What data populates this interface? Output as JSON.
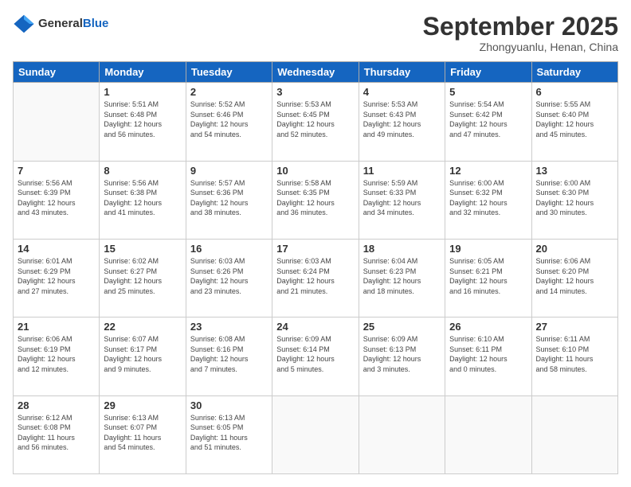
{
  "header": {
    "logo_general": "General",
    "logo_blue": "Blue",
    "month_title": "September 2025",
    "subtitle": "Zhongyuanlu, Henan, China"
  },
  "weekdays": [
    "Sunday",
    "Monday",
    "Tuesday",
    "Wednesday",
    "Thursday",
    "Friday",
    "Saturday"
  ],
  "weeks": [
    [
      {
        "day": "",
        "info": ""
      },
      {
        "day": "1",
        "info": "Sunrise: 5:51 AM\nSunset: 6:48 PM\nDaylight: 12 hours\nand 56 minutes."
      },
      {
        "day": "2",
        "info": "Sunrise: 5:52 AM\nSunset: 6:46 PM\nDaylight: 12 hours\nand 54 minutes."
      },
      {
        "day": "3",
        "info": "Sunrise: 5:53 AM\nSunset: 6:45 PM\nDaylight: 12 hours\nand 52 minutes."
      },
      {
        "day": "4",
        "info": "Sunrise: 5:53 AM\nSunset: 6:43 PM\nDaylight: 12 hours\nand 49 minutes."
      },
      {
        "day": "5",
        "info": "Sunrise: 5:54 AM\nSunset: 6:42 PM\nDaylight: 12 hours\nand 47 minutes."
      },
      {
        "day": "6",
        "info": "Sunrise: 5:55 AM\nSunset: 6:40 PM\nDaylight: 12 hours\nand 45 minutes."
      }
    ],
    [
      {
        "day": "7",
        "info": "Sunrise: 5:56 AM\nSunset: 6:39 PM\nDaylight: 12 hours\nand 43 minutes."
      },
      {
        "day": "8",
        "info": "Sunrise: 5:56 AM\nSunset: 6:38 PM\nDaylight: 12 hours\nand 41 minutes."
      },
      {
        "day": "9",
        "info": "Sunrise: 5:57 AM\nSunset: 6:36 PM\nDaylight: 12 hours\nand 38 minutes."
      },
      {
        "day": "10",
        "info": "Sunrise: 5:58 AM\nSunset: 6:35 PM\nDaylight: 12 hours\nand 36 minutes."
      },
      {
        "day": "11",
        "info": "Sunrise: 5:59 AM\nSunset: 6:33 PM\nDaylight: 12 hours\nand 34 minutes."
      },
      {
        "day": "12",
        "info": "Sunrise: 6:00 AM\nSunset: 6:32 PM\nDaylight: 12 hours\nand 32 minutes."
      },
      {
        "day": "13",
        "info": "Sunrise: 6:00 AM\nSunset: 6:30 PM\nDaylight: 12 hours\nand 30 minutes."
      }
    ],
    [
      {
        "day": "14",
        "info": "Sunrise: 6:01 AM\nSunset: 6:29 PM\nDaylight: 12 hours\nand 27 minutes."
      },
      {
        "day": "15",
        "info": "Sunrise: 6:02 AM\nSunset: 6:27 PM\nDaylight: 12 hours\nand 25 minutes."
      },
      {
        "day": "16",
        "info": "Sunrise: 6:03 AM\nSunset: 6:26 PM\nDaylight: 12 hours\nand 23 minutes."
      },
      {
        "day": "17",
        "info": "Sunrise: 6:03 AM\nSunset: 6:24 PM\nDaylight: 12 hours\nand 21 minutes."
      },
      {
        "day": "18",
        "info": "Sunrise: 6:04 AM\nSunset: 6:23 PM\nDaylight: 12 hours\nand 18 minutes."
      },
      {
        "day": "19",
        "info": "Sunrise: 6:05 AM\nSunset: 6:21 PM\nDaylight: 12 hours\nand 16 minutes."
      },
      {
        "day": "20",
        "info": "Sunrise: 6:06 AM\nSunset: 6:20 PM\nDaylight: 12 hours\nand 14 minutes."
      }
    ],
    [
      {
        "day": "21",
        "info": "Sunrise: 6:06 AM\nSunset: 6:19 PM\nDaylight: 12 hours\nand 12 minutes."
      },
      {
        "day": "22",
        "info": "Sunrise: 6:07 AM\nSunset: 6:17 PM\nDaylight: 12 hours\nand 9 minutes."
      },
      {
        "day": "23",
        "info": "Sunrise: 6:08 AM\nSunset: 6:16 PM\nDaylight: 12 hours\nand 7 minutes."
      },
      {
        "day": "24",
        "info": "Sunrise: 6:09 AM\nSunset: 6:14 PM\nDaylight: 12 hours\nand 5 minutes."
      },
      {
        "day": "25",
        "info": "Sunrise: 6:09 AM\nSunset: 6:13 PM\nDaylight: 12 hours\nand 3 minutes."
      },
      {
        "day": "26",
        "info": "Sunrise: 6:10 AM\nSunset: 6:11 PM\nDaylight: 12 hours\nand 0 minutes."
      },
      {
        "day": "27",
        "info": "Sunrise: 6:11 AM\nSunset: 6:10 PM\nDaylight: 11 hours\nand 58 minutes."
      }
    ],
    [
      {
        "day": "28",
        "info": "Sunrise: 6:12 AM\nSunset: 6:08 PM\nDaylight: 11 hours\nand 56 minutes."
      },
      {
        "day": "29",
        "info": "Sunrise: 6:13 AM\nSunset: 6:07 PM\nDaylight: 11 hours\nand 54 minutes."
      },
      {
        "day": "30",
        "info": "Sunrise: 6:13 AM\nSunset: 6:05 PM\nDaylight: 11 hours\nand 51 minutes."
      },
      {
        "day": "",
        "info": ""
      },
      {
        "day": "",
        "info": ""
      },
      {
        "day": "",
        "info": ""
      },
      {
        "day": "",
        "info": ""
      }
    ]
  ]
}
